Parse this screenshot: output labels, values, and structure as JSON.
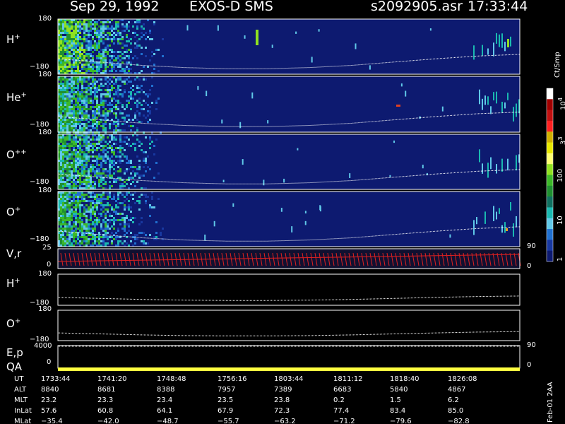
{
  "header": {
    "date": "Sep 29, 1992",
    "instrument": "EXOS-D SMS",
    "file": "s2092905.asr",
    "time": "17:33:44"
  },
  "chart_data": {
    "type": "heatmap",
    "panels": [
      {
        "species": "H",
        "charge": "+",
        "kind": "spectrogram",
        "ytop": "180",
        "ybot": "−180"
      },
      {
        "species": "He",
        "charge": "+",
        "kind": "spectrogram",
        "ytop": "180",
        "ybot": "−180"
      },
      {
        "species": "O",
        "charge": "++",
        "kind": "spectrogram",
        "ytop": "180",
        "ybot": "−180"
      },
      {
        "species": "O",
        "charge": "+",
        "kind": "spectrogram",
        "ytop": "180",
        "ybot": "−180"
      },
      {
        "label": "V,r",
        "kind": "velocity",
        "ytop": "25",
        "ybot": "0",
        "right_tick": "90",
        "right_bottom": "0"
      },
      {
        "species": "H",
        "charge": "+",
        "kind": "pitch",
        "ytop": "180",
        "ybot": "−180"
      },
      {
        "species": "O",
        "charge": "+",
        "kind": "pitch",
        "ytop": "180",
        "ybot": "−180"
      },
      {
        "label": "E,p",
        "kind": "energy",
        "ytop": "4000",
        "right_tick": "90"
      },
      {
        "label": "QA",
        "kind": "quality",
        "ybot": "0",
        "right_bottom": "0"
      }
    ],
    "colorbar": {
      "unit": "Ct/Smp",
      "ticks": [
        "10",
        "3",
        "100",
        "10",
        "1"
      ],
      "exps": [
        "4",
        "3",
        "",
        "",
        ""
      ],
      "colors": [
        "#ffffff",
        "#a00000",
        "#c01010",
        "#ff2020",
        "#d0b000",
        "#e8e800",
        "#ffff70",
        "#90e020",
        "#3cb828",
        "#1f8f30",
        "#107060",
        "#1ab8b0",
        "#60c8e8",
        "#2070d0",
        "#1838a0",
        "#0d1a70"
      ]
    },
    "pitch_curve": [
      0.72,
      0.78,
      0.84,
      0.88,
      0.9,
      0.9,
      0.88,
      0.84,
      0.78,
      0.72,
      0.67,
      0.64
    ],
    "footer": {
      "rows": [
        {
          "label": "UT",
          "values": [
            "1733:44",
            "1741:20",
            "1748:48",
            "1756:16",
            "1803:44",
            "1811:12",
            "1818:40",
            "1826:08"
          ]
        },
        {
          "label": "ALT",
          "values": [
            "8840",
            "8681",
            "8388",
            "7957",
            "7389",
            "6683",
            "5840",
            "4867"
          ]
        },
        {
          "label": "MLT",
          "values": [
            "23.2",
            "23.3",
            "23.4",
            "23.5",
            "23.8",
            "0.2",
            "1.5",
            "6.2"
          ]
        },
        {
          "label": "InLat",
          "values": [
            "57.6",
            "60.8",
            "64.1",
            "67.9",
            "72.3",
            "77.4",
            "83.4",
            "85.0"
          ]
        },
        {
          "label": "MLat",
          "values": [
            "−35.4",
            "−42.0",
            "−48.7",
            "−55.7",
            "−63.2",
            "−71.2",
            "−79.6",
            "−82.8"
          ]
        }
      ]
    },
    "stamp": "Feb-01 2AA"
  }
}
